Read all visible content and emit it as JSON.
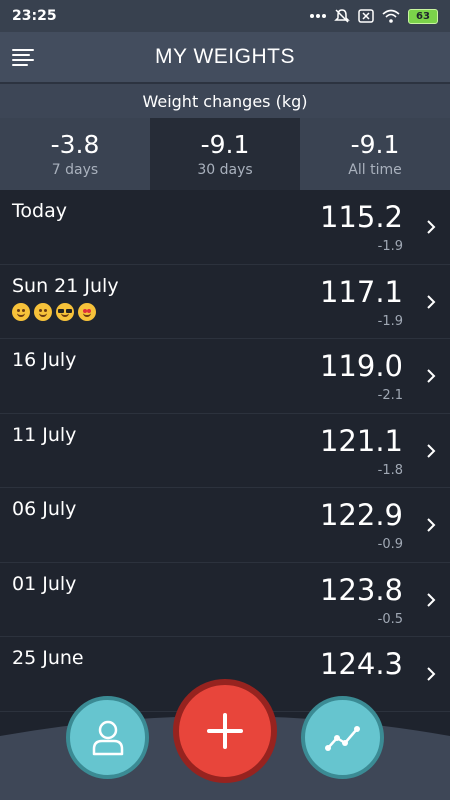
{
  "status_bar": {
    "time": "23:25",
    "battery": "63",
    "icons": [
      "more-dots-icon",
      "mute-icon",
      "sim-icon",
      "wifi-icon",
      "battery-icon"
    ]
  },
  "app_bar": {
    "title": "MY WEIGHTS",
    "menu_icon": "hamburger-menu-icon"
  },
  "changes": {
    "heading": "Weight changes (kg)",
    "periods": [
      {
        "value": "-3.8",
        "label": "7 days"
      },
      {
        "value": "-9.1",
        "label": "30 days"
      },
      {
        "value": "-9.1",
        "label": "All time"
      }
    ],
    "selected_index": 1
  },
  "entries": [
    {
      "date": "Today",
      "weight": "115.2",
      "diff": "-1.9",
      "emojis": []
    },
    {
      "date": "Sun 21 July",
      "weight": "117.1",
      "diff": "-1.9",
      "emojis": [
        "smile-emoji",
        "yum-emoji",
        "sunglasses-emoji",
        "heart-eyes-emoji"
      ]
    },
    {
      "date": "16 July",
      "weight": "119.0",
      "diff": "-2.1",
      "emojis": []
    },
    {
      "date": "11 July",
      "weight": "121.1",
      "diff": "-1.8",
      "emojis": []
    },
    {
      "date": "06 July",
      "weight": "122.9",
      "diff": "-0.9",
      "emojis": []
    },
    {
      "date": "01 July",
      "weight": "123.8",
      "diff": "-0.5",
      "emojis": []
    },
    {
      "date": "25 June",
      "weight": "124.3",
      "diff": "",
      "emojis": []
    }
  ],
  "fabs": {
    "profile_icon": "person-icon",
    "add_icon": "plus-icon",
    "chart_icon": "trend-chart-icon"
  },
  "colors": {
    "background": "#1e232d",
    "header": "#434d5e",
    "accent_teal": "#66c5cf",
    "accent_red": "#e8453b"
  }
}
